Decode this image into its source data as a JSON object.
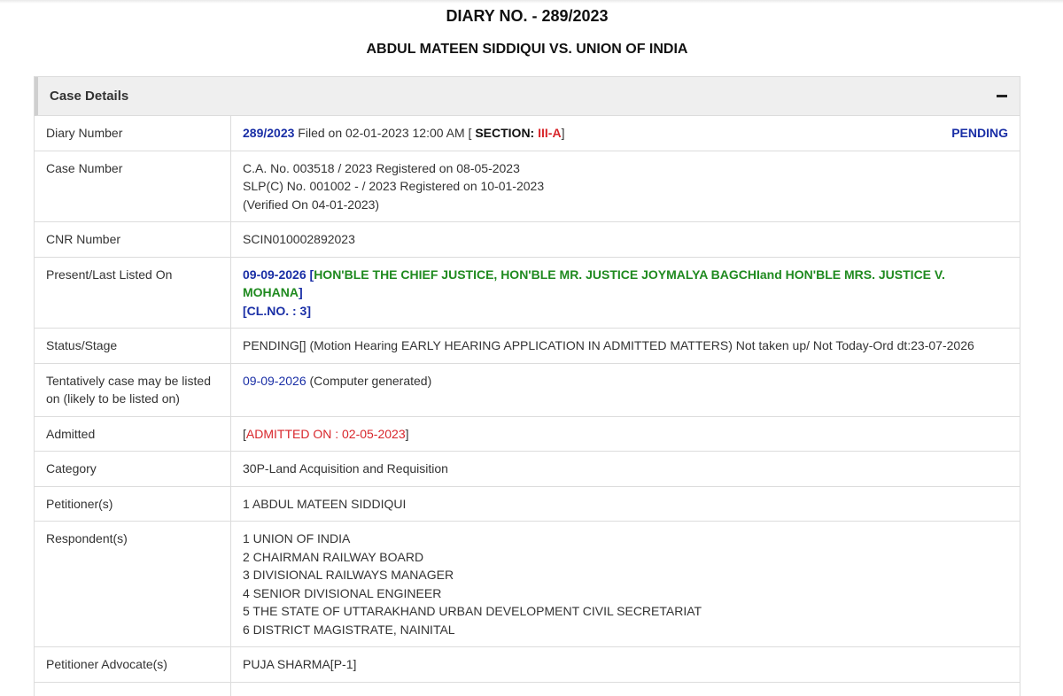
{
  "header": {
    "diary_title": "DIARY NO. - 289/2023",
    "case_title": "ABDUL MATEEN SIDDIQUI VS. UNION OF INDIA"
  },
  "panel": {
    "title": "Case Details"
  },
  "rows": {
    "diary_number": {
      "label": "Diary Number",
      "number": "289/2023",
      "filed_text": " Filed on 02-01-2023 12:00 AM [ ",
      "section_label": "SECTION: ",
      "section_value": "III-A",
      "close_bracket": "]",
      "status": "PENDING"
    },
    "case_number": {
      "label": "Case Number",
      "lines": [
        "C.A. No. 003518 / 2023 Registered on 08-05-2023",
        "SLP(C) No. 001002 - / 2023 Registered on 10-01-2023",
        "(Verified On 04-01-2023)"
      ]
    },
    "cnr_number": {
      "label": "CNR Number",
      "value": "SCIN010002892023"
    },
    "present_listed": {
      "label": "Present/Last Listed On",
      "date": "09-09-2026",
      "open_bracket": " [",
      "bench": "HON'BLE THE CHIEF JUSTICE, HON'BLE MR. JUSTICE JOYMALYA BAGCHIand HON'BLE MRS. JUSTICE V. MOHANA",
      "close_bracket": "]",
      "cl_no": "[CL.NO. : 3]"
    },
    "status_stage": {
      "label": "Status/Stage",
      "value": "PENDING[] (Motion Hearing EARLY HEARING APPLICATION IN ADMITTED MATTERS) Not taken up/ Not Today-Ord dt:23-07-2026"
    },
    "tentative": {
      "label": "Tentatively case may be listed on (likely to be listed on)",
      "date": "09-09-2026",
      "note": " (Computer generated)"
    },
    "admitted": {
      "label": "Admitted",
      "open_bracket": "[",
      "value": "ADMITTED ON : 02-05-2023",
      "close_bracket": "]"
    },
    "category": {
      "label": "Category",
      "value": "30P-Land Acquisition and Requisition"
    },
    "petitioners": {
      "label": "Petitioner(s)",
      "value": "1 ABDUL MATEEN SIDDIQUI"
    },
    "respondents": {
      "label": "Respondent(s)",
      "lines": [
        "1 UNION OF INDIA",
        "2 CHAIRMAN RAILWAY BOARD",
        "3 DIVISIONAL RAILWAYS MANAGER",
        "4 SENIOR DIVISIONAL ENGINEER",
        "5 THE STATE OF UTTARAKHAND URBAN DEVELOPMENT CIVIL SECRETARIAT",
        "6 DISTRICT MAGISTRATE, NAINITAL"
      ]
    },
    "petitioner_advocate": {
      "label": "Petitioner Advocate(s)",
      "value": "PUJA SHARMA[P-1]"
    }
  },
  "colors": {
    "blue": "#1a2fa6",
    "red": "#d8262b",
    "green": "#1f8a1f"
  },
  "icons": {
    "collapse": "minus-icon"
  }
}
